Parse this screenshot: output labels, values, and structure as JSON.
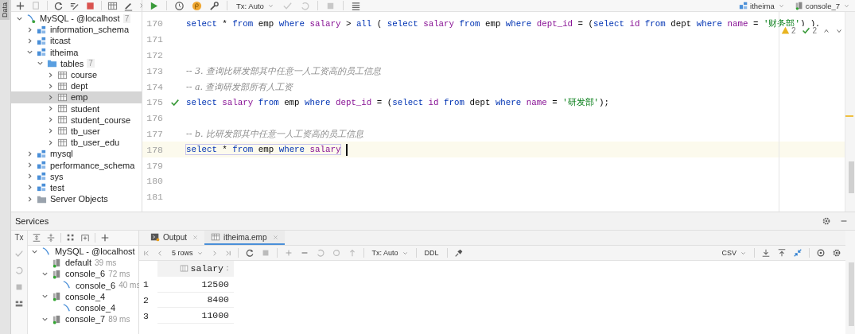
{
  "sidebar_tab": {
    "label": "Data"
  },
  "db_tree": [
    {
      "label": "MySQL - @localhost",
      "kind": "server",
      "badge": "7",
      "expanded": true,
      "selected": false,
      "children": [
        {
          "label": "information_schema",
          "kind": "schema",
          "expanded": false,
          "selected": false
        },
        {
          "label": "itcast",
          "kind": "schema",
          "expanded": false,
          "selected": false
        },
        {
          "label": "itheima",
          "kind": "schema",
          "expanded": true,
          "selected": false,
          "children": [
            {
              "label": "tables",
              "kind": "folder",
              "badge": "7",
              "expanded": true,
              "selected": false,
              "children": [
                {
                  "label": "course",
                  "kind": "table",
                  "expanded": false,
                  "selected": false
                },
                {
                  "label": "dept",
                  "kind": "table",
                  "expanded": false,
                  "selected": false
                },
                {
                  "label": "emp",
                  "kind": "table",
                  "expanded": false,
                  "selected": true
                },
                {
                  "label": "student",
                  "kind": "table",
                  "expanded": false,
                  "selected": false
                },
                {
                  "label": "student_course",
                  "kind": "table",
                  "expanded": false,
                  "selected": false
                },
                {
                  "label": "tb_user",
                  "kind": "table",
                  "expanded": false,
                  "selected": false
                },
                {
                  "label": "tb_user_edu",
                  "kind": "table",
                  "expanded": false,
                  "selected": false
                }
              ]
            }
          ]
        },
        {
          "label": "mysql",
          "kind": "schema",
          "expanded": false,
          "selected": false
        },
        {
          "label": "performance_schema",
          "kind": "schema",
          "expanded": false,
          "selected": false
        },
        {
          "label": "sys",
          "kind": "schema",
          "expanded": false,
          "selected": false
        },
        {
          "label": "test",
          "kind": "schema",
          "expanded": false,
          "selected": false
        },
        {
          "label": "Server Objects",
          "kind": "folder-objects",
          "expanded": false,
          "selected": false
        }
      ]
    }
  ],
  "editor_toolbar": {
    "tx_mode": "Tx: Auto",
    "datasource": "itheima",
    "session": "console_7"
  },
  "inspections": {
    "warnings": "2",
    "passed": "2"
  },
  "code_lines": [
    {
      "number": "170",
      "current": false,
      "executed": false,
      "tokens": [
        {
          "kind": "keyword",
          "text": "select"
        },
        {
          "kind": "plain",
          "text": " * "
        },
        {
          "kind": "keyword",
          "text": "from"
        },
        {
          "kind": "plain",
          "text": " emp "
        },
        {
          "kind": "keyword",
          "text": "where"
        },
        {
          "kind": "column",
          "text": " salary"
        },
        {
          "kind": "plain",
          "text": " > "
        },
        {
          "kind": "keyword",
          "text": "all"
        },
        {
          "kind": "plain",
          "text": " ( "
        },
        {
          "kind": "keyword",
          "text": "select"
        },
        {
          "kind": "column",
          "text": " salary"
        },
        {
          "kind": "keyword",
          "text": " from"
        },
        {
          "kind": "plain",
          "text": " emp "
        },
        {
          "kind": "keyword",
          "text": "where"
        },
        {
          "kind": "column",
          "text": " dept_id"
        },
        {
          "kind": "plain",
          "text": " = ("
        },
        {
          "kind": "keyword",
          "text": "select"
        },
        {
          "kind": "column",
          "text": " id"
        },
        {
          "kind": "keyword",
          "text": " from"
        },
        {
          "kind": "plain",
          "text": " dept "
        },
        {
          "kind": "keyword",
          "text": "where"
        },
        {
          "kind": "column",
          "text": " name"
        },
        {
          "kind": "plain",
          "text": " = "
        },
        {
          "kind": "string",
          "text": "'财务部'"
        },
        {
          "kind": "plain",
          "text": ") ),"
        }
      ]
    },
    {
      "number": "171",
      "current": false,
      "executed": false
    },
    {
      "number": "172",
      "current": false,
      "executed": false
    },
    {
      "number": "173",
      "current": false,
      "executed": false,
      "tokens": [
        {
          "kind": "comment",
          "text": "-- 3. 查询比研发部其中任意一人工资高的员工信息"
        }
      ]
    },
    {
      "number": "174",
      "current": false,
      "executed": false,
      "tokens": [
        {
          "kind": "comment",
          "text": "-- a. 查询研发部所有人工资"
        }
      ]
    },
    {
      "number": "175",
      "current": false,
      "executed": true,
      "tokens": [
        {
          "kind": "keyword",
          "text": "select"
        },
        {
          "kind": "column",
          "text": " salary"
        },
        {
          "kind": "keyword",
          "text": " from"
        },
        {
          "kind": "plain",
          "text": " emp "
        },
        {
          "kind": "keyword",
          "text": "where"
        },
        {
          "kind": "column",
          "text": " dept_id"
        },
        {
          "kind": "plain",
          "text": " = ("
        },
        {
          "kind": "keyword",
          "text": "select"
        },
        {
          "kind": "column",
          "text": " id"
        },
        {
          "kind": "keyword",
          "text": " from"
        },
        {
          "kind": "plain",
          "text": " dept "
        },
        {
          "kind": "keyword",
          "text": "where"
        },
        {
          "kind": "column",
          "text": " name"
        },
        {
          "kind": "plain",
          "text": " = "
        },
        {
          "kind": "string",
          "text": "'研发部'"
        },
        {
          "kind": "plain",
          "text": ");"
        }
      ]
    },
    {
      "number": "176",
      "current": false,
      "executed": false
    },
    {
      "number": "177",
      "current": false,
      "executed": false,
      "tokens": [
        {
          "kind": "comment",
          "text": "-- b. 比研发部其中任意一人工资高的员工信息"
        }
      ]
    },
    {
      "number": "178",
      "current": true,
      "executed": false,
      "tokens": [
        {
          "kind": "keyword",
          "text": "select"
        },
        {
          "kind": "plain",
          "text": " * "
        },
        {
          "kind": "keyword",
          "text": "from"
        },
        {
          "kind": "plain",
          "text": " emp "
        },
        {
          "kind": "keyword",
          "text": "where"
        },
        {
          "kind": "column",
          "text": " salary"
        }
      ]
    },
    {
      "number": "179",
      "current": false,
      "executed": false
    },
    {
      "number": "180",
      "current": false,
      "executed": false
    },
    {
      "number": "181",
      "current": false,
      "executed": false
    }
  ],
  "services": {
    "title": "Services",
    "tx_label": "Tx",
    "tree": [
      {
        "label": "MySQL - @localhost",
        "kind": "connection",
        "expanded": true,
        "children": [
          {
            "label": "default",
            "time": "39 ms",
            "kind": "session"
          },
          {
            "label": "console_6",
            "time": "72 ms",
            "kind": "session",
            "expanded": true,
            "children": [
              {
                "label": "console_6",
                "time": "40 ms",
                "kind": "console"
              }
            ]
          },
          {
            "label": "console_4",
            "kind": "session",
            "expanded": true,
            "children": [
              {
                "label": "console_4",
                "kind": "console"
              }
            ]
          },
          {
            "label": "console_7",
            "time": "89 ms",
            "kind": "session",
            "expanded": true
          }
        ]
      }
    ],
    "tabs": [
      {
        "label": "Output",
        "kind": "output",
        "selected": false
      },
      {
        "label": "itheima.emp",
        "kind": "table",
        "selected": true
      }
    ],
    "toolbar": {
      "rows": "5 rows",
      "tx_mode": "Tx: Auto",
      "ddl": "DDL",
      "format": "CSV"
    },
    "table": {
      "columns": [
        "salary"
      ],
      "rows": [
        {
          "number": "1",
          "values": [
            "12500"
          ]
        },
        {
          "number": "2",
          "values": [
            "8400"
          ]
        },
        {
          "number": "3",
          "values": [
            "11000"
          ]
        }
      ]
    }
  }
}
